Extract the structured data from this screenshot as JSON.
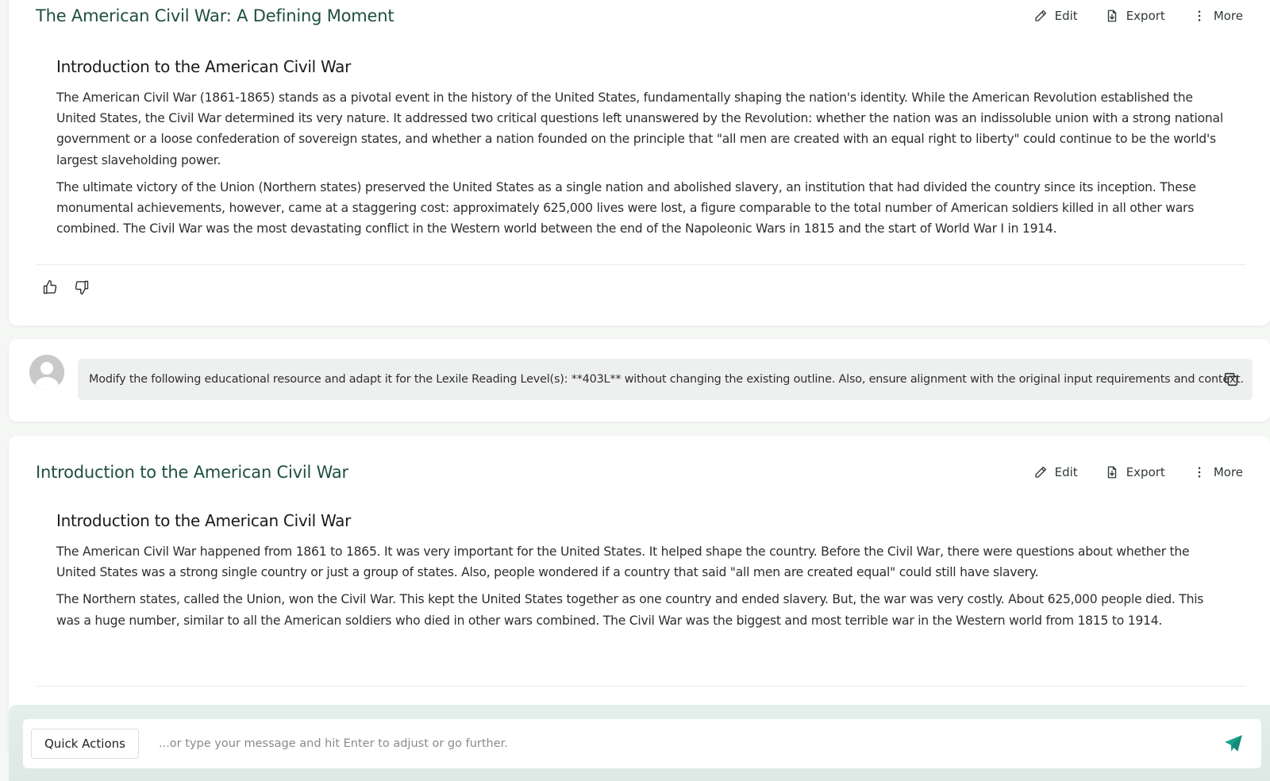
{
  "response_1": {
    "title": "The American Civil War: A Defining Moment",
    "actions": {
      "edit": "Edit",
      "export": "Export",
      "more": "More"
    },
    "heading": "Introduction to the American Civil War",
    "paragraphs": [
      "The American Civil War (1861-1865) stands as a pivotal event in the history of the United States, fundamentally shaping the nation's identity. While the American Revolution established the United States, the Civil War determined its very nature. It addressed two critical questions left unanswered by the Revolution: whether the nation was an indissoluble union with a strong national government or a loose confederation of sovereign states, and whether a nation founded on the principle that \"all men are created with an equal right to liberty\" could continue to be the world's largest slaveholding power.",
      "The ultimate victory of the Union (Northern states) preserved the United States as a single nation and abolished slavery, an institution that had divided the country since its inception. These monumental achievements, however, came at a staggering cost: approximately 625,000 lives were lost, a figure comparable to the total number of American soldiers killed in all other wars combined. The Civil War was the most devastating conflict in the Western world between the end of the Napoleonic Wars in 1815 and the start of World War I in 1914."
    ]
  },
  "user_prompt": {
    "text": "Modify the following educational resource and adapt it for the Lexile Reading Level(s): **403L** without changing the existing outline. Also, ensure alignment with the original input requirements and context."
  },
  "response_2": {
    "title": "Introduction to the American Civil War",
    "actions": {
      "edit": "Edit",
      "export": "Export",
      "more": "More"
    },
    "heading": "Introduction to the American Civil War",
    "paragraphs": [
      "The American Civil War happened from 1861 to 1865. It was very important for the United States. It helped shape the country. Before the Civil War, there were questions about whether the United States was a strong single country or just a group of states. Also, people wondered if a country that said \"all men are created equal\" could still have slavery.",
      "The Northern states, called the Union, won the Civil War. This kept the United States together as one country and ended slavery. But, the war was very costly. About 625,000 people died. This was a huge number, similar to all the American soldiers who died in other wars combined. The Civil War was the biggest and most terrible war in the Western world from 1815 to 1914."
    ]
  },
  "composer": {
    "quick_actions_label": "Quick Actions",
    "placeholder": "...or type your message and hit Enter to adjust or go further."
  },
  "colors": {
    "title": "#1f4e43",
    "send": "#1aa08c",
    "background": "#f5f7f5"
  }
}
